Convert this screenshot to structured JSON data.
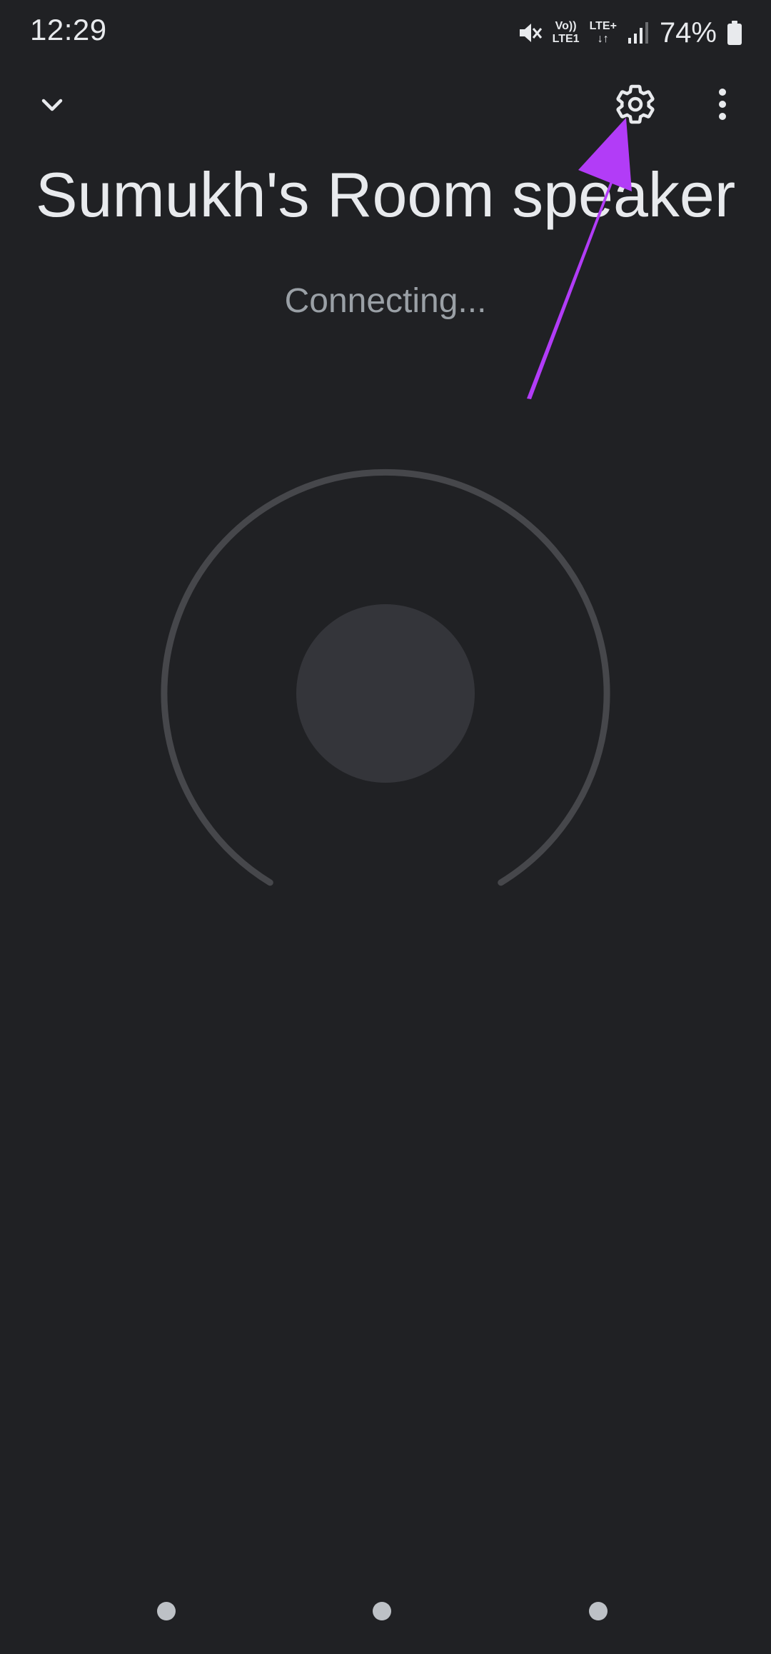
{
  "status_bar": {
    "time": "12:29",
    "volte_top": "Vo))",
    "volte_bottom": "LTE1",
    "lte_top": "LTE+",
    "lte_bottom": "↓↑",
    "battery_percent": "74%",
    "battery_level": 0.74,
    "icons": [
      "mute-icon",
      "signal-icon",
      "battery-icon"
    ]
  },
  "app_bar": {
    "collapse_icon": "chevron-down-icon",
    "settings_icon": "gear-icon",
    "more_icon": "more-vertical-icon"
  },
  "device": {
    "name": "Sumukh's Room speaker",
    "status": "Connecting..."
  },
  "colors": {
    "background": "#202124",
    "text_primary": "#e8eaed",
    "text_secondary": "#9aa0a6",
    "dial_track": "#46474b",
    "dial_knob": "#34353a",
    "annotation_arrow": "#b23cf7"
  }
}
